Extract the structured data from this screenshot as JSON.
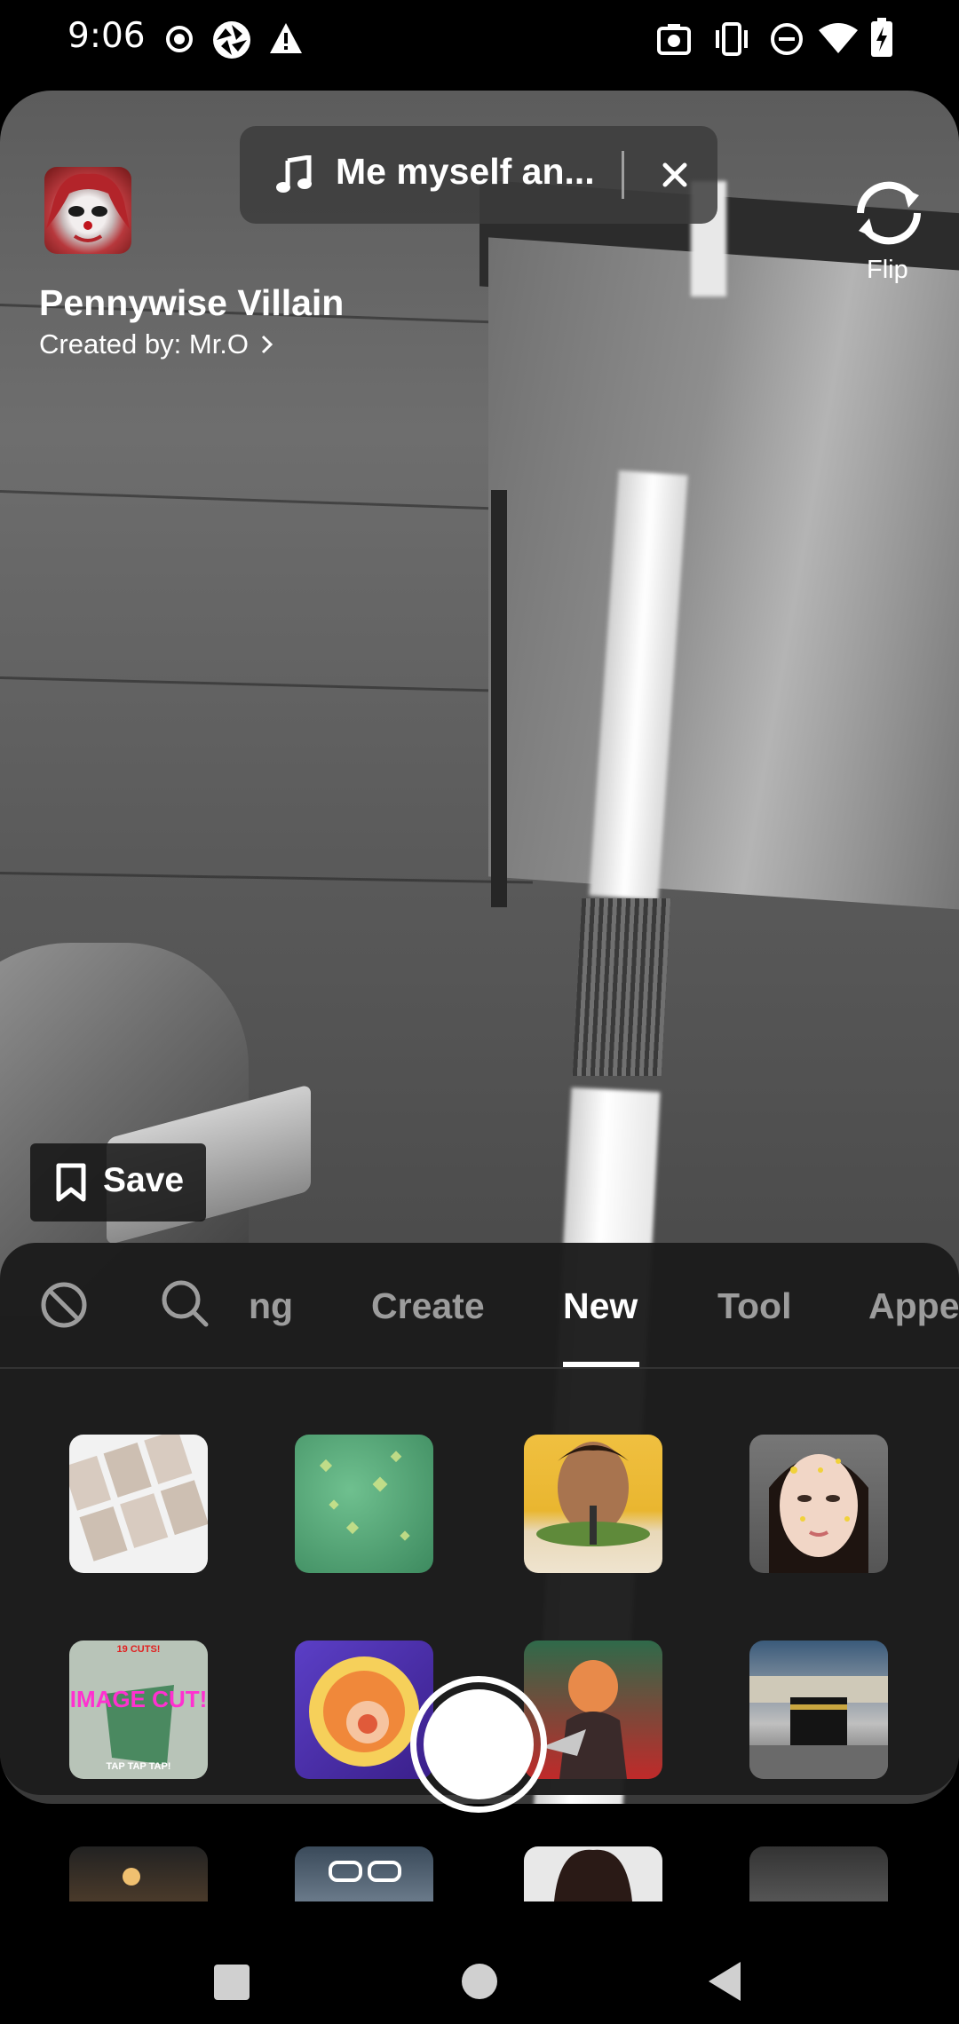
{
  "status_bar": {
    "time": "9:06"
  },
  "music": {
    "title": "Me myself an..."
  },
  "effect": {
    "name": "Pennywise Villain",
    "creator": "Created by: Mr.O"
  },
  "flip": {
    "label": "Flip"
  },
  "save": {
    "label": "Save"
  },
  "tabs": [
    "ng",
    "Create",
    "New",
    "Tool",
    "Appe"
  ],
  "active_tab": "New",
  "effect_tiles": [
    {
      "label_top": "",
      "label_mid": "",
      "label_bottom": ""
    },
    {
      "label_top": "19 CUTS!",
      "label_mid": "IMAGE CUT!",
      "label_bottom": "TAP TAP TAP!"
    }
  ],
  "colors": {
    "panel_bg": "#1c1c1c",
    "tab_inactive": "#9c9c9c",
    "tab_active": "#ffffff"
  }
}
